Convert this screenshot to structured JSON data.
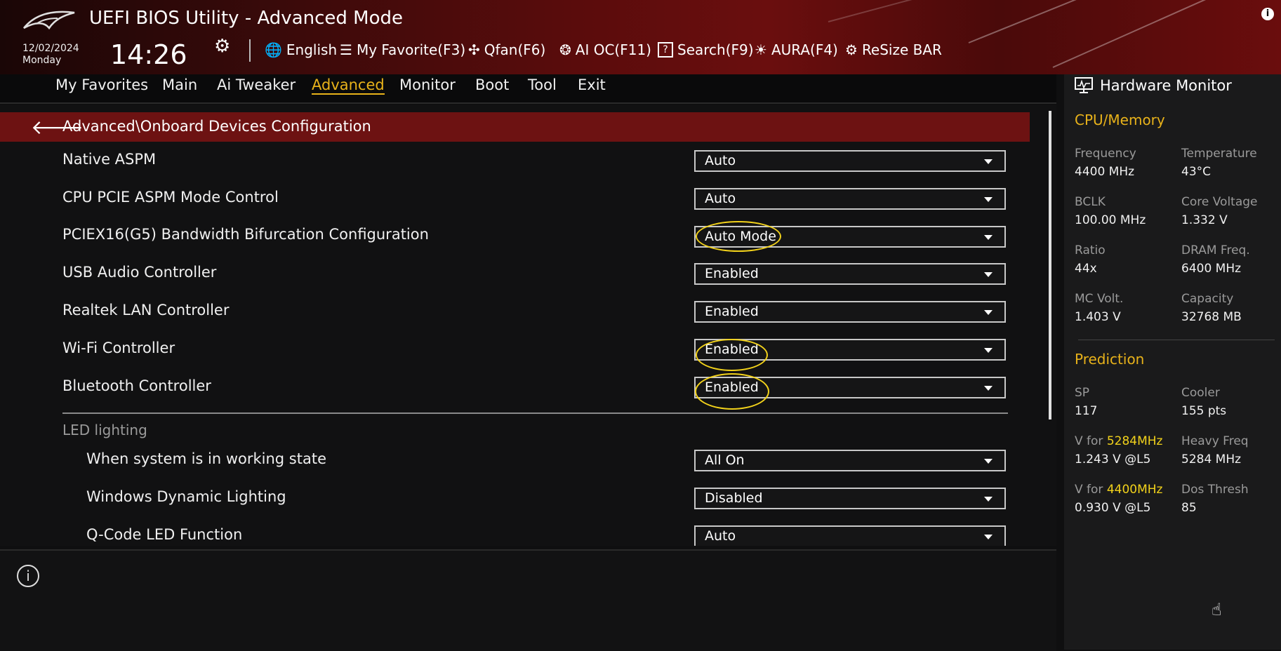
{
  "header": {
    "title": "UEFI BIOS Utility - Advanced Mode",
    "date": "12/02/2024",
    "day": "Monday",
    "time": "14:26",
    "tools": [
      {
        "icon": "globe-icon",
        "glyph": "🌐",
        "label": "English"
      },
      {
        "icon": "favorite-icon",
        "glyph": "☰",
        "label": "My Favorite(F3)"
      },
      {
        "icon": "fan-icon",
        "glyph": "✣",
        "label": "Qfan(F6)"
      },
      {
        "icon": "brain-icon",
        "glyph": "❂",
        "label": "AI OC(F11)"
      },
      {
        "icon": "search-help-icon",
        "glyph": "?",
        "label": "Search(F9)"
      },
      {
        "icon": "aura-icon",
        "glyph": "☀",
        "label": "AURA(F4)"
      },
      {
        "icon": "resize-bar-icon",
        "glyph": "⚙",
        "label": "ReSize BAR"
      }
    ]
  },
  "tabs": [
    {
      "label": "My Favorites"
    },
    {
      "label": "Main"
    },
    {
      "label": "Ai Tweaker"
    },
    {
      "label": "Advanced",
      "active": true
    },
    {
      "label": "Monitor"
    },
    {
      "label": "Boot"
    },
    {
      "label": "Tool"
    },
    {
      "label": "Exit"
    }
  ],
  "breadcrumb": "Advanced\\Onboard Devices Configuration",
  "settings": [
    {
      "label": "Native ASPM",
      "value": "Auto"
    },
    {
      "label": "CPU PCIE ASPM Mode Control",
      "value": "Auto"
    },
    {
      "label": "PCIEX16(G5) Bandwidth Bifurcation Configuration",
      "value": "Auto Mode"
    },
    {
      "label": "USB Audio Controller",
      "value": "Enabled"
    },
    {
      "label": "Realtek LAN Controller",
      "value": "Enabled"
    },
    {
      "label": "Wi-Fi Controller",
      "value": "Enabled"
    },
    {
      "label": "Bluetooth Controller",
      "value": "Enabled"
    }
  ],
  "led_section": {
    "title": "LED lighting",
    "items": [
      {
        "label": "When system is in working state",
        "value": "All On"
      },
      {
        "label": "Windows Dynamic Lighting",
        "value": "Disabled"
      },
      {
        "label": "Q-Code LED Function",
        "value": "Auto"
      }
    ]
  },
  "hardware_monitor": {
    "title": "Hardware Monitor",
    "cpu_memory": {
      "title": "CPU/Memory",
      "items": [
        {
          "label": "Frequency",
          "value": "4400 MHz"
        },
        {
          "label": "Temperature",
          "value": "43°C"
        },
        {
          "label": "BCLK",
          "value": "100.00 MHz"
        },
        {
          "label": "Core Voltage",
          "value": "1.332 V"
        },
        {
          "label": "Ratio",
          "value": "44x"
        },
        {
          "label": "DRAM Freq.",
          "value": "6400 MHz"
        },
        {
          "label": "MC Volt.",
          "value": "1.403 V"
        },
        {
          "label": "Capacity",
          "value": "32768 MB"
        }
      ]
    },
    "prediction": {
      "title": "Prediction",
      "sp_label": "SP",
      "sp_value": "117",
      "cooler_label": "Cooler",
      "cooler_value": "155 pts",
      "v1_prefix": "V for ",
      "v1_freq": "5284MHz",
      "v1_value": "1.243 V @L5",
      "heavy_label": "Heavy Freq",
      "heavy_value": "5284 MHz",
      "v2_prefix": "V for ",
      "v2_freq": "4400MHz",
      "v2_value": "0.930 V @L5",
      "dos_label": "Dos Thresh",
      "dos_value": "85"
    }
  },
  "colors": {
    "accent": "#e8b21a",
    "highlight": "#f2d21b",
    "breadcrumb_bg": "#6d1212",
    "header_red": "#6a0e0e"
  }
}
